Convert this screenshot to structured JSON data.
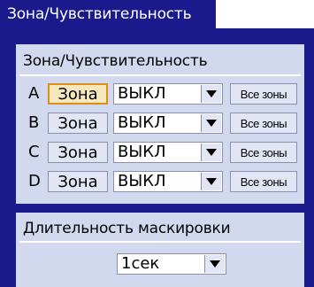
{
  "tab": {
    "title": "Зона/Чувствительность"
  },
  "zone_section": {
    "title": "Зона/Чувствительность",
    "rows": [
      {
        "letter": "A",
        "zone_label": "Зона",
        "value": "ВЫКЛ",
        "all_label": "Все зоны",
        "focused": true
      },
      {
        "letter": "B",
        "zone_label": "Зона",
        "value": "ВЫКЛ",
        "all_label": "Все зоны",
        "focused": false
      },
      {
        "letter": "C",
        "zone_label": "Зона",
        "value": "ВЫКЛ",
        "all_label": "Все зоны",
        "focused": false
      },
      {
        "letter": "D",
        "zone_label": "Зона",
        "value": "ВЫКЛ",
        "all_label": "Все зоны",
        "focused": false
      }
    ]
  },
  "mask_section": {
    "title": "Длительность маскировки",
    "value": "1сек"
  },
  "colors": {
    "frame": "#1a1a8c",
    "panel": "#d2d8ee",
    "focus": "#e08a1a"
  }
}
